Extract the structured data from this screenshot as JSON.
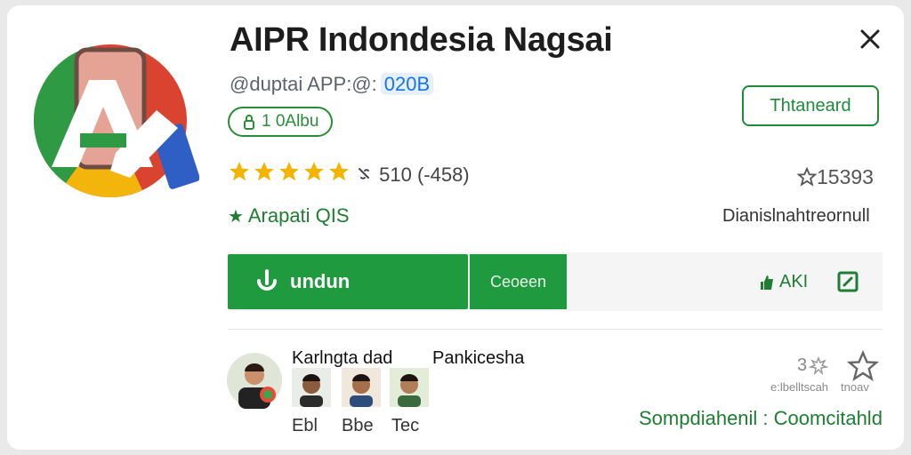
{
  "app": {
    "title": "AIPR Indondesia Nagsai",
    "handle": "@duptai APP:@:",
    "code": "020B",
    "install_label": "Thtaneard",
    "badge": "1 0Albu"
  },
  "rating": {
    "stars": 5,
    "text": "510 (-458)",
    "right_count": "15393"
  },
  "info": {
    "green_text": "Arapati QIS",
    "right_text": "Dianislnahtreornull"
  },
  "actions": {
    "download": "undun",
    "secondary": "Ceoeen",
    "apk": "AKI"
  },
  "developer": {
    "name": "Karlngta dad",
    "subtitle": "Pankicesha",
    "members": [
      "Ebl",
      "Bbe",
      "Tec"
    ],
    "share_count": "3",
    "small_left": "e:lbelltscah",
    "small_right": "tnoav",
    "footer": "Sompdiahenil : Coomcitahld"
  },
  "colors": {
    "green": "#1f9a3e",
    "accent_blue": "#1a73e8",
    "star": "#f5b400"
  },
  "icons": [
    "close-icon",
    "lock-icon",
    "star-icon",
    "link-icon",
    "download-icon",
    "thumb-up-icon",
    "edit-icon",
    "share-icon"
  ]
}
